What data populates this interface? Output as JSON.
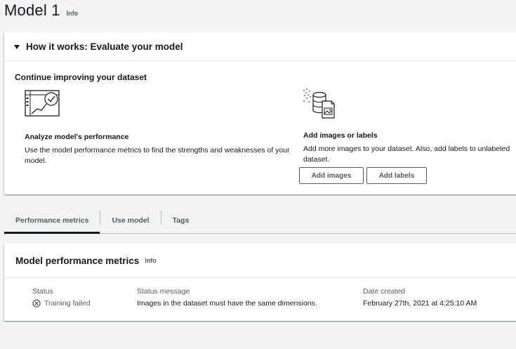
{
  "page": {
    "title": "Model 1",
    "info": "Info"
  },
  "how_it_works": {
    "title": "How it works: Evaluate your model",
    "section_heading": "Continue improving your dataset",
    "analyze": {
      "icon": "performance-chart-icon",
      "title": "Analyze model's performance",
      "description": "Use the model performance metrics to find the strengths and weaknesses of your model."
    },
    "add": {
      "icon": "dataset-images-icon",
      "title": "Add images or labels",
      "description": "Add more images to your dataset. Also, add labels to unlabeled dataset."
    },
    "buttons": {
      "add_images": "Add images",
      "add_labels": "Add labels"
    }
  },
  "tabs": [
    {
      "label": "Performance metrics",
      "active": true
    },
    {
      "label": "Use model",
      "active": false
    },
    {
      "label": "Tags",
      "active": false
    }
  ],
  "metrics": {
    "title": "Model performance metrics",
    "info": "Info",
    "status_label": "Status",
    "status_value": "Training failed",
    "status_icon": "error-circle-icon",
    "message_label": "Status message",
    "message_value": "Images in the dataset must have the same dimensions.",
    "date_label": "Date created",
    "date_value": "February 27th, 2021 at 4:25:10 AM"
  },
  "colors": {
    "text": "#16191f",
    "muted": "#545b64",
    "border": "#aab7b8",
    "background": "#f2f3f3"
  }
}
